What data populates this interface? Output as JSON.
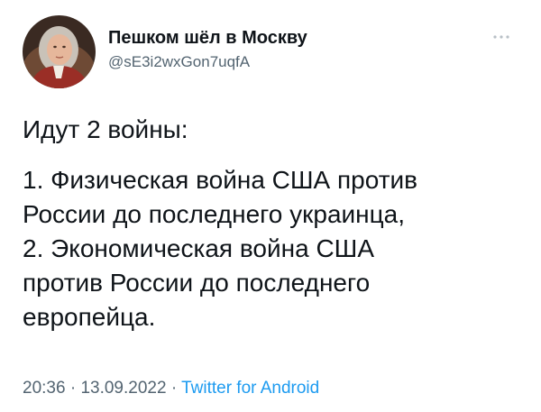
{
  "author": {
    "display_name": "Пешком шёл в Москву",
    "handle": "@sE3i2wxGon7uqfA",
    "avatar_icon": "portrait-avatar"
  },
  "tweet": {
    "lines_intro": "Идут 2 войны:",
    "body_lines": [
      "1. Физическая война США против",
      "России до последнего украинца,",
      "2. Экономическая война США",
      "против России до последнего",
      "европейца."
    ]
  },
  "meta": {
    "time": "20:36",
    "separator": "·",
    "date": "13.09.2022",
    "source": "Twitter for Android"
  },
  "colors": {
    "text": "#0f1419",
    "secondary": "#536471",
    "link": "#1d9bf0"
  }
}
